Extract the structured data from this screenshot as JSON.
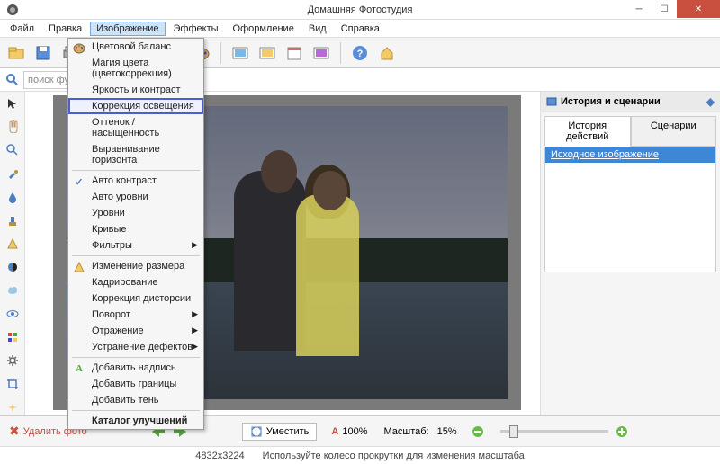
{
  "app": {
    "title": "Домашняя Фотостудия"
  },
  "menu": {
    "items": [
      "Файл",
      "Правка",
      "Изображение",
      "Эффекты",
      "Оформление",
      "Вид",
      "Справка"
    ],
    "active_index": 2
  },
  "dropdown": {
    "groups": [
      [
        {
          "label": "Цветовой баланс",
          "icon": "palette"
        },
        {
          "label": "Магия цвета (цветокоррекция)"
        },
        {
          "label": "Яркость и контраст"
        },
        {
          "label": "Коррекция освещения",
          "highlight": true
        },
        {
          "label": "Оттенок / насыщенность"
        },
        {
          "label": "Выравнивание горизонта"
        }
      ],
      [
        {
          "label": "Авто контраст",
          "icon": "check"
        },
        {
          "label": "Авто уровни"
        },
        {
          "label": "Уровни"
        },
        {
          "label": "Кривые"
        },
        {
          "label": "Фильтры",
          "submenu": true
        }
      ],
      [
        {
          "label": "Изменение размера",
          "icon": "warn"
        },
        {
          "label": "Кадрирование"
        },
        {
          "label": "Коррекция дисторсии"
        },
        {
          "label": "Поворот",
          "submenu": true
        },
        {
          "label": "Отражение",
          "submenu": true
        },
        {
          "label": "Устранение дефектов",
          "submenu": true
        }
      ],
      [
        {
          "label": "Добавить надпись",
          "icon": "text-a"
        },
        {
          "label": "Добавить границы"
        },
        {
          "label": "Добавить тень"
        }
      ],
      [
        {
          "label": "Каталог улучшений",
          "bold": true
        }
      ]
    ]
  },
  "search": {
    "placeholder": "поиск фу"
  },
  "sidepanel": {
    "title": "История и сценарии",
    "tabs": [
      "История действий",
      "Сценарии"
    ],
    "entry": "Исходное изображение"
  },
  "bottombar": {
    "delete_label": "Удалить фото",
    "fit_label": "Уместить",
    "zoom_percent": "100%",
    "scale_label": "Масштаб:",
    "scale_value": "15%"
  },
  "statusbar": {
    "dimensions": "4832x3224",
    "hint": "Используйте колесо прокрутки для изменения масштаба"
  }
}
